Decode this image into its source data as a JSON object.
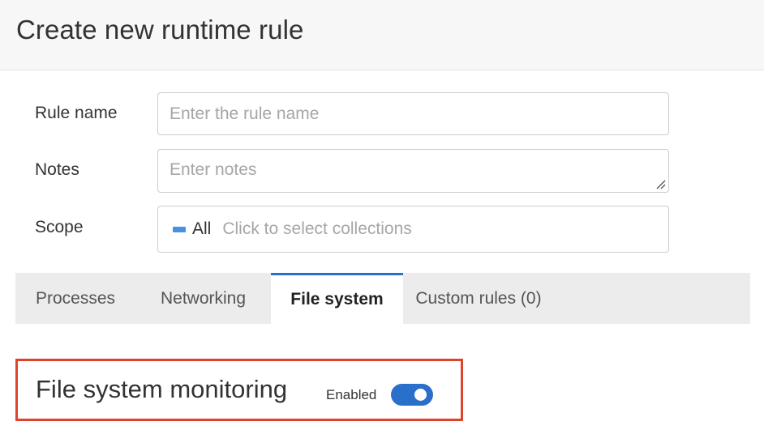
{
  "header": {
    "title": "Create new runtime rule"
  },
  "form": {
    "rule_name": {
      "label": "Rule name",
      "placeholder": "Enter the rule name",
      "value": ""
    },
    "notes": {
      "label": "Notes",
      "placeholder": "Enter notes",
      "value": ""
    },
    "scope": {
      "label": "Scope",
      "selected": "All",
      "placeholder": "Click to select collections"
    }
  },
  "tabs": [
    {
      "label": "Processes",
      "active": false
    },
    {
      "label": "Networking",
      "active": false
    },
    {
      "label": "File system",
      "active": true
    },
    {
      "label": "Custom rules (0)",
      "active": false
    }
  ],
  "section": {
    "title": "File system monitoring",
    "toggle_label": "Enabled",
    "toggle_on": true
  },
  "colors": {
    "accent": "#2a6fc9",
    "highlight": "#e0432b",
    "scope_marker": "#4a90e2"
  }
}
